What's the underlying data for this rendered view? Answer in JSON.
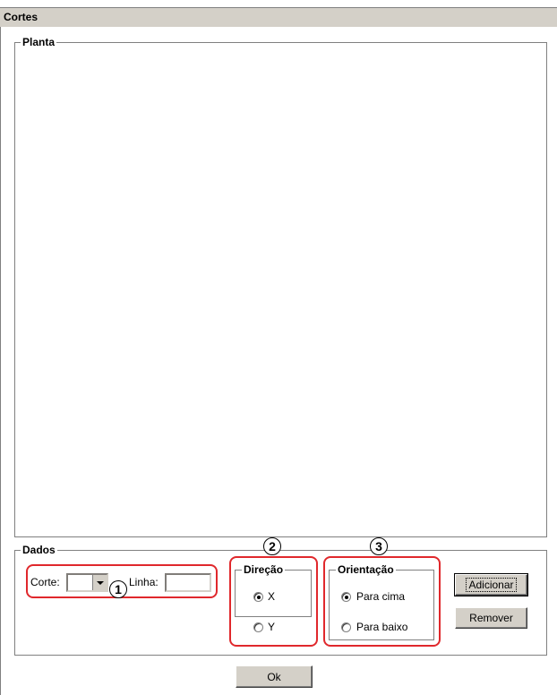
{
  "window": {
    "title": "Cortes"
  },
  "planta": {
    "label": "Planta"
  },
  "dados": {
    "label": "Dados",
    "corte_label": "Corte:",
    "corte_value": "",
    "linha_label": "Linha:",
    "linha_value": ""
  },
  "direcao": {
    "label": "Direção",
    "options": [
      {
        "label": "X",
        "selected": true
      },
      {
        "label": "Y",
        "selected": false
      }
    ]
  },
  "orientacao": {
    "label": "Orientação",
    "options": [
      {
        "label": "Para cima",
        "selected": true
      },
      {
        "label": "Para baixo",
        "selected": false
      }
    ]
  },
  "buttons": {
    "adicionar": "Adicionar",
    "remover": "Remover",
    "ok": "Ok"
  },
  "annotations": [
    "1",
    "2",
    "3"
  ],
  "colors": {
    "annotation_red": "#e0282c",
    "window_gray": "#d4d0c8"
  }
}
